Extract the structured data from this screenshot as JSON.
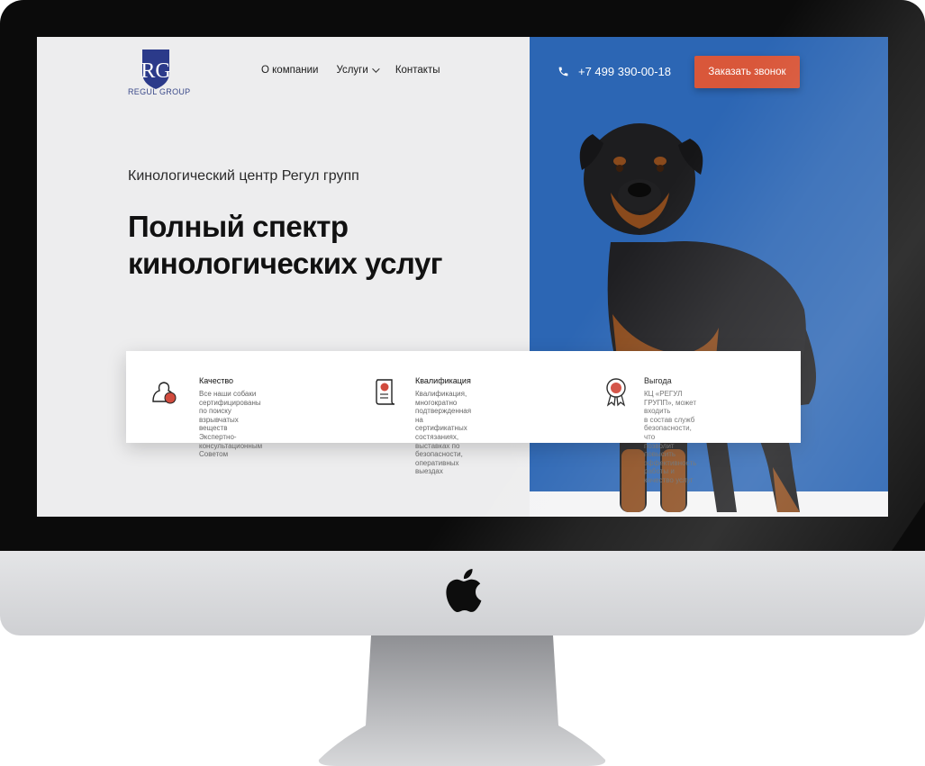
{
  "logo": {
    "mark": "RG",
    "name": "REGUL GROUP"
  },
  "nav": {
    "about": "О компании",
    "services": "Услуги",
    "contacts": "Контакты"
  },
  "header": {
    "phone": "+7 499 390-00-18",
    "cta": "Заказать звонок"
  },
  "hero": {
    "subtitle": "Кинологический центр Регул групп",
    "title_line1": "Полный спектр",
    "title_line2": "кинологических услуг"
  },
  "features": [
    {
      "title": "Качество",
      "line1": "Все наши собаки сертифицированы",
      "line2": "по поиску взрывчатых веществ",
      "line3": "Экспертно-консультационным",
      "line4": "Советом",
      "icon": "dog-certificate-icon"
    },
    {
      "title": "Квалификация",
      "line1": "Квалификация, многократно",
      "line2": "подтвержденная на сертификатных",
      "line3": "состязаниях, выставках по",
      "line4": "безопасности, оперативных выездах",
      "icon": "scroll-diploma-icon"
    },
    {
      "title": "Выгода",
      "line1": "КЦ «РЕГУЛ ГРУПП», может входить",
      "line2": "в состав служб безопасности, что",
      "line3": "позволит повысить эффективность",
      "line4": "работы и качество услуг",
      "icon": "award-medal-icon"
    }
  ],
  "colors": {
    "accent": "#d9573a",
    "blue": "#2c66b4",
    "brand": "#2b3a8a"
  }
}
